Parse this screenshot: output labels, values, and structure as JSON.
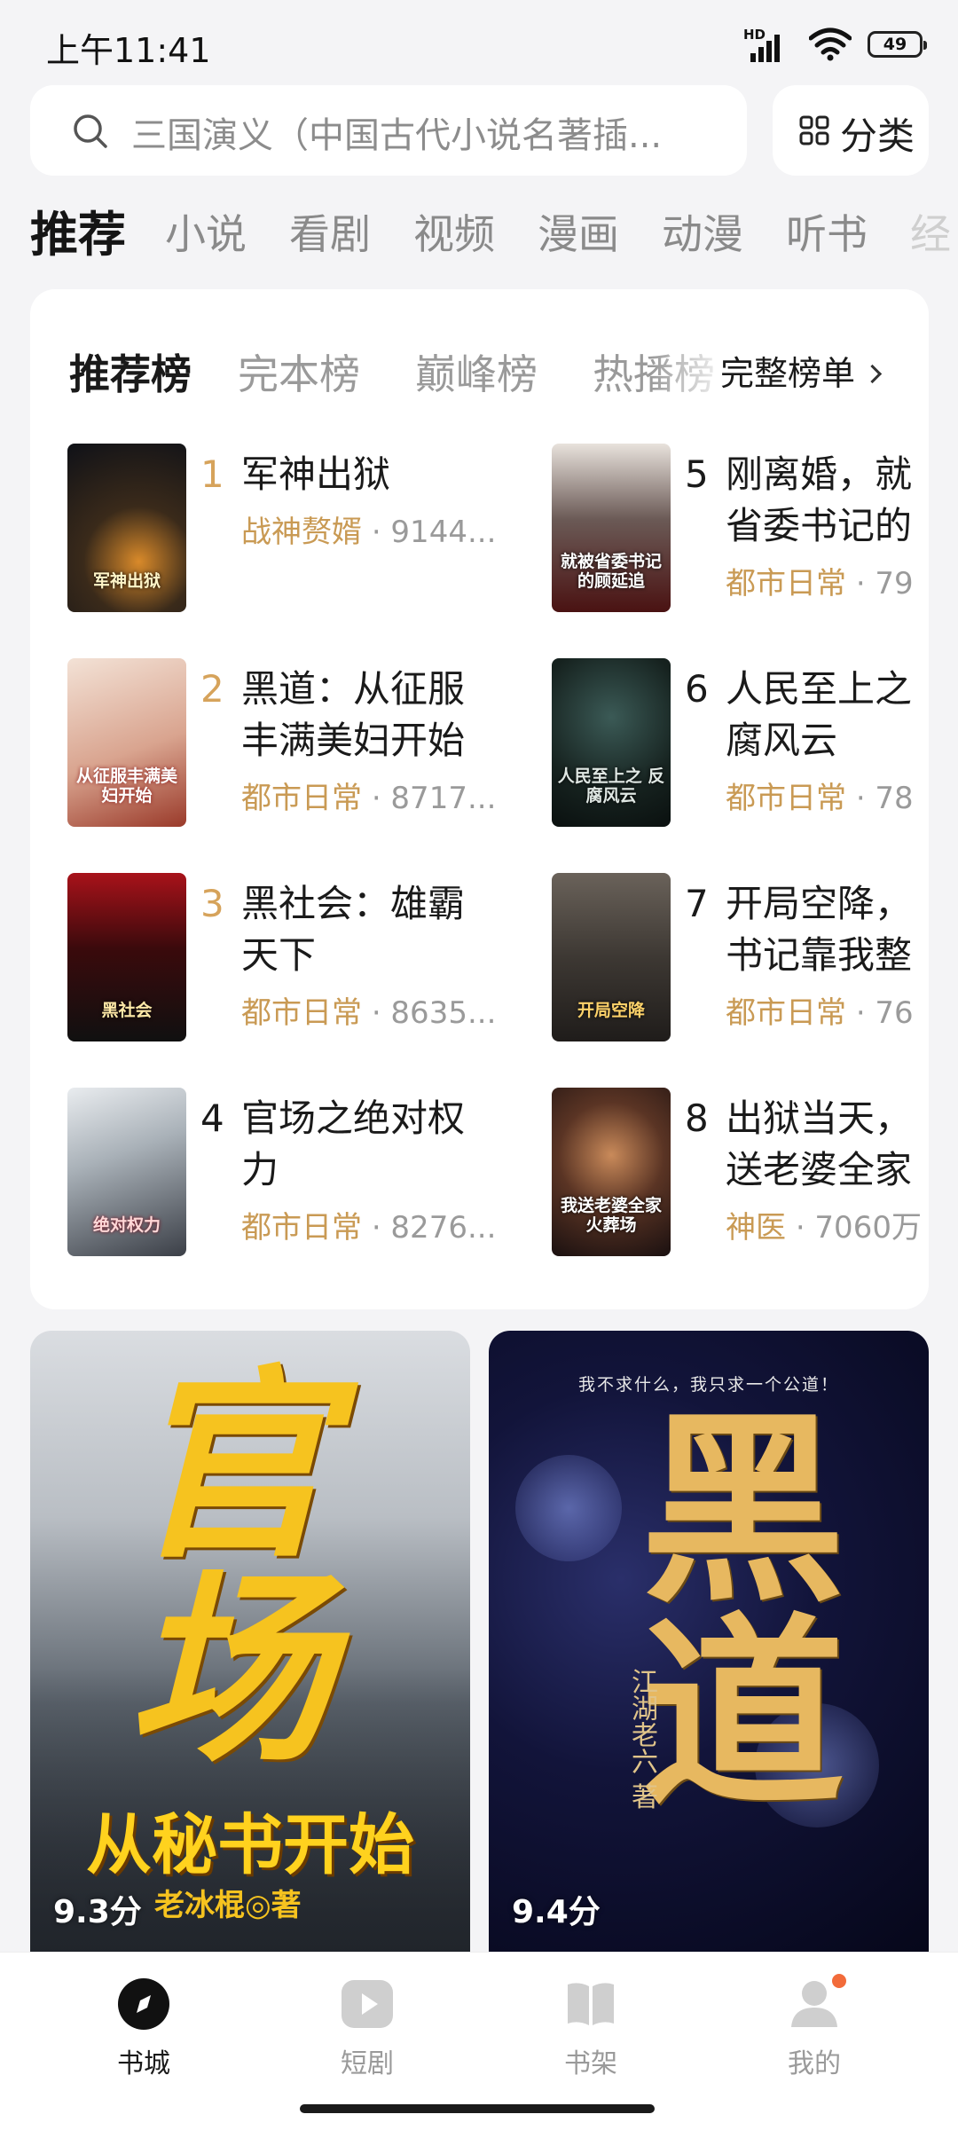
{
  "status_bar": {
    "time": "上午11:41",
    "network": "HD",
    "battery": "49"
  },
  "search": {
    "placeholder": "三国演义（中国古代小说名著插...",
    "category_label": "分类"
  },
  "channel_tabs": [
    "推荐",
    "小说",
    "看剧",
    "视频",
    "漫画",
    "动漫",
    "听书",
    "经"
  ],
  "ranking": {
    "tabs": [
      "推荐榜",
      "完本榜",
      "巅峰榜",
      "热播榜"
    ],
    "full_list_label": "完整榜单",
    "books": [
      {
        "rank": "1",
        "title": "军神出狱",
        "title2": "",
        "genre": "战神赘婿",
        "count": "· 9144...",
        "cover_text": "军神出狱"
      },
      {
        "rank": "2",
        "title": "黑道：从征服",
        "title2": "丰满美妇开始",
        "genre": "都市日常",
        "count": "· 8717...",
        "cover_text": "从征服丰满美妇开始"
      },
      {
        "rank": "3",
        "title": "黑社会：雄霸",
        "title2": "天下",
        "genre": "都市日常",
        "count": "· 8635...",
        "cover_text": "黑社会"
      },
      {
        "rank": "4",
        "title": "官场之绝对权",
        "title2": "力",
        "genre": "都市日常",
        "count": "· 8276...",
        "cover_text": "绝对权力"
      },
      {
        "rank": "5",
        "title": "刚离婚，就",
        "title2": "省委书记的",
        "genre": "都市日常",
        "count": "· 79",
        "cover_text": "就被省委书记的顾延追"
      },
      {
        "rank": "6",
        "title": "人民至上之",
        "title2": "腐风云",
        "genre": "都市日常",
        "count": "· 78",
        "cover_text": "人民至上之 反腐风云"
      },
      {
        "rank": "7",
        "title": "开局空降，",
        "title2": "书记靠我整",
        "genre": "都市日常",
        "count": "· 76",
        "cover_text": "开局空降"
      },
      {
        "rank": "8",
        "title": "出狱当天，",
        "title2": "送老婆全家",
        "genre": "神医",
        "count": "· 7060万",
        "cover_text": "我送老婆全家火葬场"
      }
    ]
  },
  "featured": [
    {
      "title": "官场",
      "subtitle": "从秘书开始",
      "author": "老冰棍◎著",
      "score": "9.3分"
    },
    {
      "title": "黑道",
      "tagline": "我不求什么，我只求一个公道！",
      "author": "江湖老六 著",
      "score": "9.4分"
    }
  ],
  "bottom_nav": [
    {
      "label": "书城",
      "icon": "compass-icon",
      "active": true
    },
    {
      "label": "短剧",
      "icon": "play-icon",
      "active": false
    },
    {
      "label": "书架",
      "icon": "book-icon",
      "active": false
    },
    {
      "label": "我的",
      "icon": "user-icon",
      "active": false
    }
  ],
  "colors": {
    "accent": "#c99a54",
    "background": "#f4f4f6",
    "badge": "#f26b3a"
  }
}
